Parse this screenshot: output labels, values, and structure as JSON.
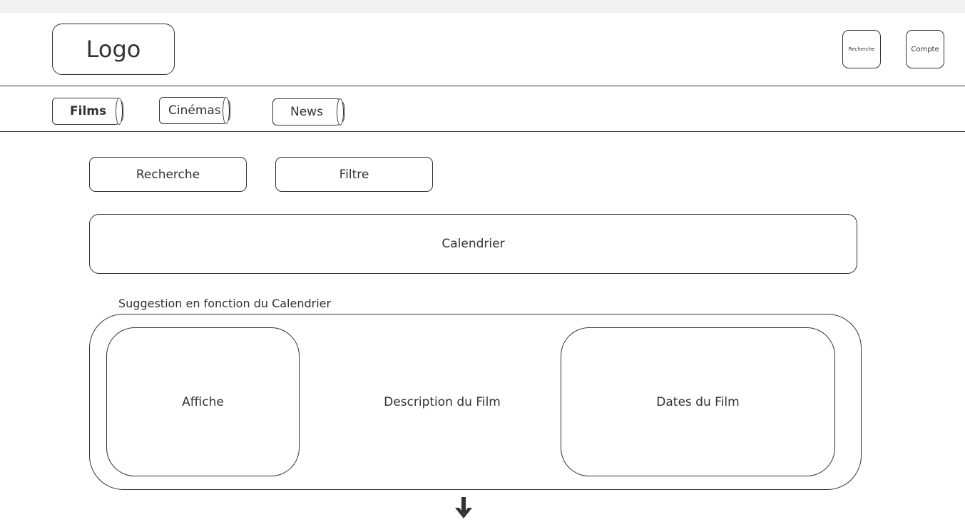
{
  "header": {
    "logo_label": "Logo",
    "search_label": "Recherche",
    "account_label": "Compte"
  },
  "nav": {
    "tabs": [
      {
        "label": "Films",
        "active": true
      },
      {
        "label": "Cinémas",
        "active": false
      },
      {
        "label": "News",
        "active": false
      }
    ]
  },
  "toolbar": {
    "search_label": "Recherche",
    "filter_label": "Filtre"
  },
  "calendar": {
    "label": "Calendrier"
  },
  "suggestion": {
    "title": "Suggestion en fonction du Calendrier",
    "poster_label": "Affiche",
    "description_label": "Description du Film",
    "dates_label": "Dates du Film"
  },
  "icons": {
    "scroll_arrow": "arrow-down-icon"
  },
  "colors": {
    "stroke": "#333333",
    "background": "#ffffff",
    "top_strip": "#f2f2f2"
  }
}
